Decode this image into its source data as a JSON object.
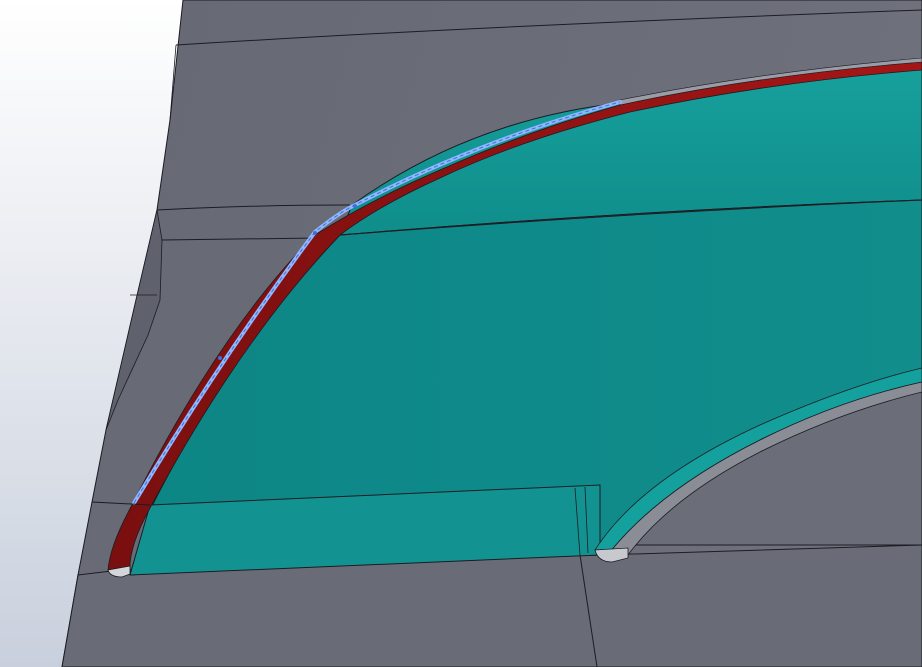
{
  "viewport": {
    "background_top": "#ffffff",
    "background_bottom": "#c9d0dd"
  },
  "colors": {
    "body_gray": "#6a6c78",
    "body_gray_dark": "#5c5e6a",
    "body_gray_light": "#777985",
    "teal_face": "#0f8a8a",
    "teal_face_light": "#16a19e",
    "teal_band": "#1a9c99",
    "red_face": "#9a1414",
    "red_face_dark": "#7a0f0f",
    "selected_edge": "#8fb6ff",
    "edge_line": "#1c1c22"
  }
}
